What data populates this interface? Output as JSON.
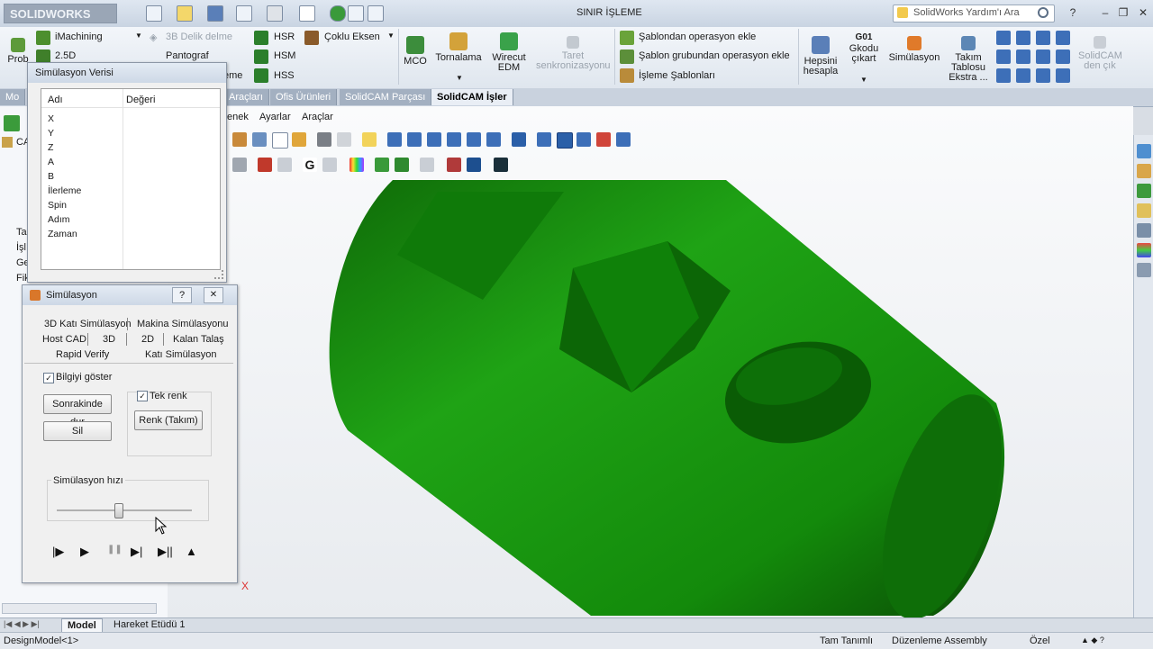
{
  "window": {
    "app_logo": "SOLIDWORKS",
    "title": "SINIR İŞLEME",
    "help_search_placeholder": "SolidWorks Yardım'ı Ara"
  },
  "ribbon": {
    "left_partial_label": "Prob",
    "group1": {
      "imachining": "iMachining",
      "two_half_d": "2.5D",
      "drill_3d": "3B Delik delme",
      "pantograf": "Pantograf",
      "hsr": "HSR",
      "hsm": "HSM",
      "hss": "HSS",
      "multi_axis": "Çoklu Eksen",
      "partial_behind": "eme"
    },
    "mco": "MCO",
    "turning": "Tornalama",
    "wirecut": "Wirecut EDM",
    "turret_sync": "Taret senkronizasyonu",
    "templates": {
      "add_op_from_template": "Şablondan operasyon ekle",
      "add_op_from_group": "Şablon grubundan operasyon ekle",
      "machining_templates": "İşleme Şablonları"
    },
    "calc_all": "Hepsini hesapla",
    "gcode": {
      "top": "G01",
      "label": "Gkodu çıkart"
    },
    "simulation": "Simülasyon",
    "tool_table": "Takım Tablosu Ekstra ...",
    "exit_solidcam": "SolidCAM den çık"
  },
  "tabs": [
    {
      "label": "Mo",
      "active": false
    },
    {
      "label": "Araçları",
      "active": false
    },
    {
      "label": "Ofis Ürünleri",
      "active": false
    },
    {
      "label": "SolidCAM Parçası",
      "active": false
    },
    {
      "label": "SolidCAM İşler",
      "active": true
    }
  ],
  "graphics_menu": [
    "enek",
    "Ayarlar",
    "Araçlar"
  ],
  "tree_partial": [
    "CA",
    "Ta",
    "İşl",
    "Ge",
    "Fik"
  ],
  "sim_data_dialog": {
    "title": "Simülasyon Verisi",
    "col_name": "Adı",
    "col_value": "Değeri",
    "rows": [
      "X",
      "Y",
      "Z",
      "A",
      "B",
      "İlerleme",
      "Spin",
      "Adım",
      "Zaman"
    ]
  },
  "sim_dialog": {
    "title": "Simülasyon",
    "help": "?",
    "close": "✕",
    "tabs_row1": [
      "3D Katı Simülasyon",
      "Makina Simülasyonu"
    ],
    "tabs_row2": [
      "Host CAD",
      "3D",
      "2D",
      "Kalan Talaş"
    ],
    "tabs_row3": [
      "Rapid Verify",
      "Katı Simülasyon"
    ],
    "show_info": {
      "label": "Bilgiyi göster",
      "checked": true
    },
    "stop_next": "Sonrakinde dur",
    "delete": "Sil",
    "single_color": {
      "label": "Tek renk",
      "checked": true
    },
    "color_tool": "Renk (Takım)",
    "speed_label": "Simülasyon hızı",
    "speed_value": 0.45,
    "controls": [
      "step-play-icon",
      "play-icon",
      "pause-icon",
      "step-forward-icon",
      "skip-end-icon",
      "eject-icon"
    ]
  },
  "axis_label": "X",
  "bottom_tabs": [
    {
      "label": "Model",
      "active": true
    },
    {
      "label": "Hareket Etüdü 1",
      "active": false
    }
  ],
  "status": {
    "left": "DesignModel<1>",
    "defined": "Tam Tanımlı",
    "editing": "Düzenleme Assembly",
    "custom": "Özel"
  },
  "colors": {
    "part_green": "#1f9a12",
    "part_dark": "#0b4a06"
  }
}
